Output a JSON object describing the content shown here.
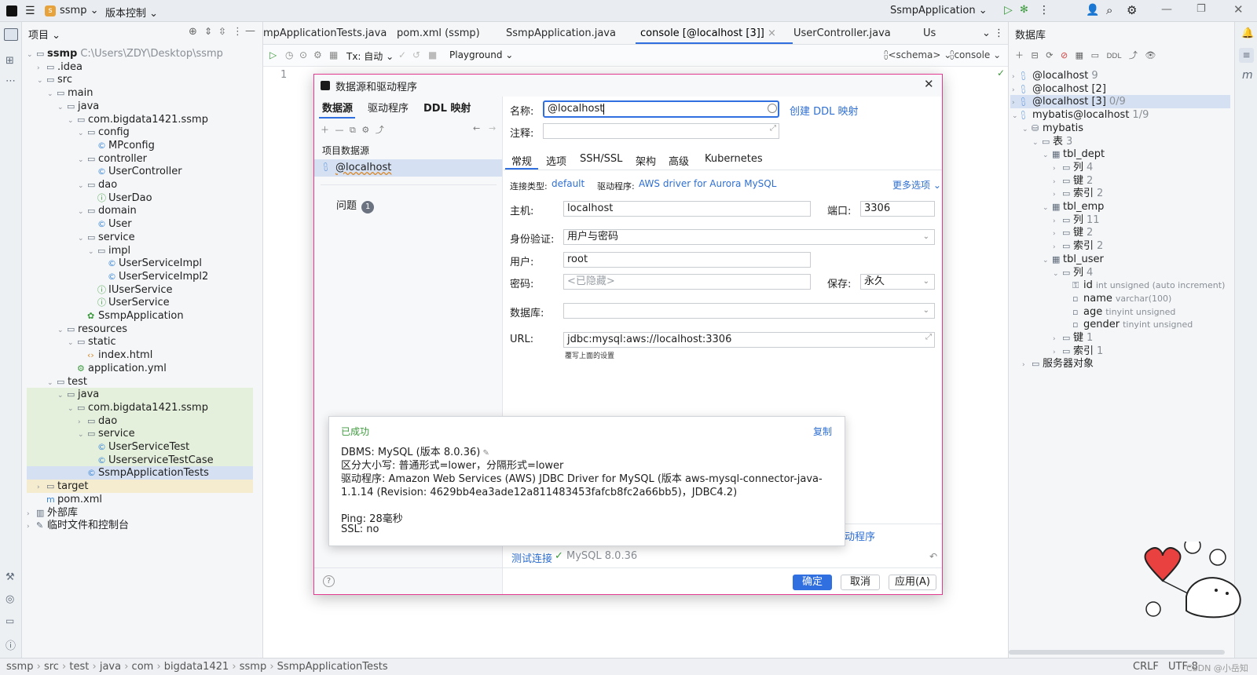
{
  "titlebar": {
    "project": "ssmp",
    "vcs": "版本控制",
    "run_config": "SsmpApplication"
  },
  "project_panel": {
    "title": "项目",
    "tree": [
      {
        "text": "ssmp",
        "suffix": "C:\\Users\\ZDY\\Desktop\\ssmp",
        "icon": "folder-icon"
      },
      {
        "text": ".idea",
        "icon": "folder-icon"
      },
      {
        "text": "src",
        "icon": "folder-icon"
      },
      {
        "text": "main",
        "icon": "folder-icon"
      },
      {
        "text": "java",
        "icon": "folder-icon"
      },
      {
        "text": "com.bigdata1421.ssmp",
        "icon": "package-icon"
      },
      {
        "text": "config",
        "icon": "package-icon"
      },
      {
        "text": "MPconfig",
        "icon": "class-icon"
      },
      {
        "text": "controller",
        "icon": "package-icon"
      },
      {
        "text": "UserController",
        "icon": "class-icon"
      },
      {
        "text": "dao",
        "icon": "package-icon"
      },
      {
        "text": "UserDao",
        "icon": "interface-icon"
      },
      {
        "text": "domain",
        "icon": "package-icon"
      },
      {
        "text": "User",
        "icon": "class-icon"
      },
      {
        "text": "service",
        "icon": "package-icon"
      },
      {
        "text": "impl",
        "icon": "package-icon"
      },
      {
        "text": "UserServiceImpl",
        "icon": "class-icon"
      },
      {
        "text": "UserServiceImpl2",
        "icon": "class-icon"
      },
      {
        "text": "IUserService",
        "icon": "interface-icon"
      },
      {
        "text": "UserService",
        "icon": "interface-icon"
      },
      {
        "text": "SsmpApplication",
        "icon": "spring-icon"
      },
      {
        "text": "resources",
        "icon": "folder-icon"
      },
      {
        "text": "static",
        "icon": "folder-icon"
      },
      {
        "text": "index.html",
        "icon": "html-icon"
      },
      {
        "text": "application.yml",
        "icon": "yaml-icon"
      },
      {
        "text": "test",
        "icon": "folder-icon"
      },
      {
        "text": "java",
        "icon": "folder-icon"
      },
      {
        "text": "com.bigdata1421.ssmp",
        "icon": "package-icon"
      },
      {
        "text": "dao",
        "icon": "package-icon"
      },
      {
        "text": "service",
        "icon": "package-icon"
      },
      {
        "text": "UserServiceTest",
        "icon": "class-icon"
      },
      {
        "text": "UserserviceTestCase",
        "icon": "class-icon"
      },
      {
        "text": "SsmpApplicationTests",
        "icon": "class-icon"
      },
      {
        "text": "target",
        "icon": "folder-icon"
      },
      {
        "text": "pom.xml",
        "icon": "maven-icon"
      },
      {
        "text": "外部库",
        "icon": "library-icon"
      },
      {
        "text": "临时文件和控制台",
        "icon": "scratch-icon"
      }
    ]
  },
  "editor_tabs": [
    "mpApplicationTests.java",
    "pom.xml (ssmp)",
    "SsmpApplication.java",
    "console [@localhost [3]]",
    "UserController.java",
    "Us"
  ],
  "editor_toolbar": {
    "tx": "Tx: 自动",
    "playground": "Playground",
    "schema": "<schema>",
    "console": "console"
  },
  "editor": {
    "line_number": "1"
  },
  "database_panel": {
    "title": "数据库",
    "tree": [
      {
        "text": "@localhost",
        "count": "9"
      },
      {
        "text": "@localhost [2]",
        "count": ""
      },
      {
        "text": "@localhost [3]",
        "count": "0/9"
      },
      {
        "text": "mybatis@localhost",
        "count": "1/9"
      },
      {
        "text": "mybatis",
        "count": ""
      },
      {
        "text": "表",
        "count": "3"
      },
      {
        "text": "tbl_dept",
        "count": ""
      },
      {
        "text": "列",
        "count": "4"
      },
      {
        "text": "键",
        "count": "2"
      },
      {
        "text": "索引",
        "count": "2"
      },
      {
        "text": "tbl_emp",
        "count": ""
      },
      {
        "text": "列",
        "count": "11"
      },
      {
        "text": "键",
        "count": "2"
      },
      {
        "text": "索引",
        "count": "2"
      },
      {
        "text": "tbl_user",
        "count": ""
      },
      {
        "text": "列",
        "count": "4"
      },
      {
        "text": "id",
        "count": "int unsigned (auto increment)"
      },
      {
        "text": "name",
        "count": "varchar(100)"
      },
      {
        "text": "age",
        "count": "tinyint unsigned"
      },
      {
        "text": "gender",
        "count": "tinyint unsigned"
      },
      {
        "text": "键",
        "count": "1"
      },
      {
        "text": "索引",
        "count": "1"
      },
      {
        "text": "服务器对象",
        "count": ""
      }
    ]
  },
  "dialog": {
    "title": "数据源和驱动程序",
    "left_tabs": [
      "数据源",
      "驱动程序",
      "DDL 映射"
    ],
    "section_project": "项目数据源",
    "datasource": "@localhost",
    "problems": "问题",
    "problems_count": "1",
    "name_label": "名称:",
    "name_value": "@localhost",
    "create_ddl": "创建 DDL 映射",
    "comment_label": "注释:",
    "subtabs": [
      "常规",
      "选项",
      "SSH/SSL",
      "架构",
      "高级",
      "Kubernetes"
    ],
    "conn_type_label": "连接类型:",
    "conn_type_value": "default",
    "driver_label": "驱动程序:",
    "driver_value": "AWS driver for Aurora MySQL",
    "more_options": "更多选项",
    "host_label": "主机:",
    "host_value": "localhost",
    "port_label": "端口:",
    "port_value": "3306",
    "auth_label": "身份验证:",
    "auth_value": "用户与密码",
    "user_label": "用户:",
    "user_value": "root",
    "password_label": "密码:",
    "password_placeholder": "<已隐藏>",
    "save_label": "保存:",
    "save_value": "永久",
    "db_label": "数据库:",
    "url_label": "URL:",
    "url_value": "jdbc:mysql:aws://localhost:3306",
    "url_hint": "覆写上面的设置",
    "test_conn": "测试连接",
    "test_result": "MySQL 8.0.36",
    "partial_link": "动程序",
    "ok": "确定",
    "cancel": "取消",
    "apply": "应用(A)"
  },
  "popup": {
    "status": "已成功",
    "copy": "复制",
    "line1": "DBMS: MySQL (版本 8.0.36)",
    "line2": "区分大小写: 普通形式=lower，分隔形式=lower",
    "line3": "驱动程序: Amazon Web Services (AWS) JDBC Driver for MySQL (版本 aws-mysql-connector-java-",
    "line4": "1.1.14 (Revision: 4629bb4ea3ade12a811483453fafcb8fc2a66bb5)，JDBC4.2)",
    "line5": "Ping: 28毫秒",
    "line6": "SSL: no"
  },
  "statusbar": {
    "breadcrumb": [
      "ssmp",
      "src",
      "test",
      "java",
      "com",
      "bigdata1421",
      "ssmp",
      "SsmpApplicationTests"
    ],
    "crlf": "CRLF",
    "encoding": "UTF-8",
    "watermark": "CSDN @小岳知"
  },
  "colors": {
    "accent": "#2f6fe0",
    "success": "#3c9a3c",
    "dialog_border": "#e23b8f"
  }
}
